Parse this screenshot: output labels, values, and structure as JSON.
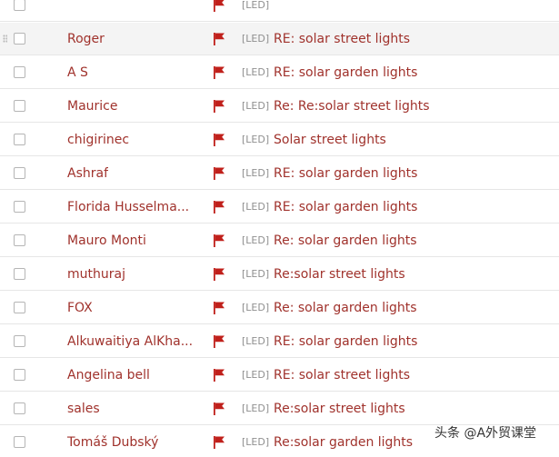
{
  "mail_list": {
    "rows": [
      {
        "sender": "",
        "tag": "[LED]",
        "subject": ""
      },
      {
        "sender": "Roger",
        "tag": "[LED]",
        "subject": "RE: solar street lights"
      },
      {
        "sender": "A S",
        "tag": "[LED]",
        "subject": "RE: solar garden lights"
      },
      {
        "sender": "Maurice",
        "tag": "[LED]",
        "subject": "Re: Re:solar street lights"
      },
      {
        "sender": "chigirinec",
        "tag": "[LED]",
        "subject": "Solar street lights"
      },
      {
        "sender": "Ashraf",
        "tag": "[LED]",
        "subject": "RE: solar garden lights"
      },
      {
        "sender": "Florida Husselma...",
        "tag": "[LED]",
        "subject": "RE: solar garden lights"
      },
      {
        "sender": "Mauro Monti",
        "tag": "[LED]",
        "subject": "Re: solar garden lights"
      },
      {
        "sender": "muthuraj",
        "tag": "[LED]",
        "subject": "Re:solar street lights"
      },
      {
        "sender": "FOX",
        "tag": "[LED]",
        "subject": "Re: solar garden lights"
      },
      {
        "sender": "Alkuwaitiya AlKha...",
        "tag": "[LED]",
        "subject": "RE: solar garden lights"
      },
      {
        "sender": "Angelina bell",
        "tag": "[LED]",
        "subject": "RE: solar street lights"
      },
      {
        "sender": "sales",
        "tag": "[LED]",
        "subject": "Re:solar street lights"
      },
      {
        "sender": "Tomáš Dubský",
        "tag": "[LED]",
        "subject": "Re:solar garden lights"
      }
    ]
  },
  "watermark": "头条 @A外贸课堂",
  "colors": {
    "sender_text": "#a0322c",
    "subject_text": "#a0322c",
    "flag": "#c0201b",
    "tag_text": "#8f8f8f",
    "hover_row": "#f4f4f4",
    "divider": "#e6e6e6"
  },
  "icons": {
    "flag": "flag-icon",
    "drag": "drag-handle-icon"
  }
}
